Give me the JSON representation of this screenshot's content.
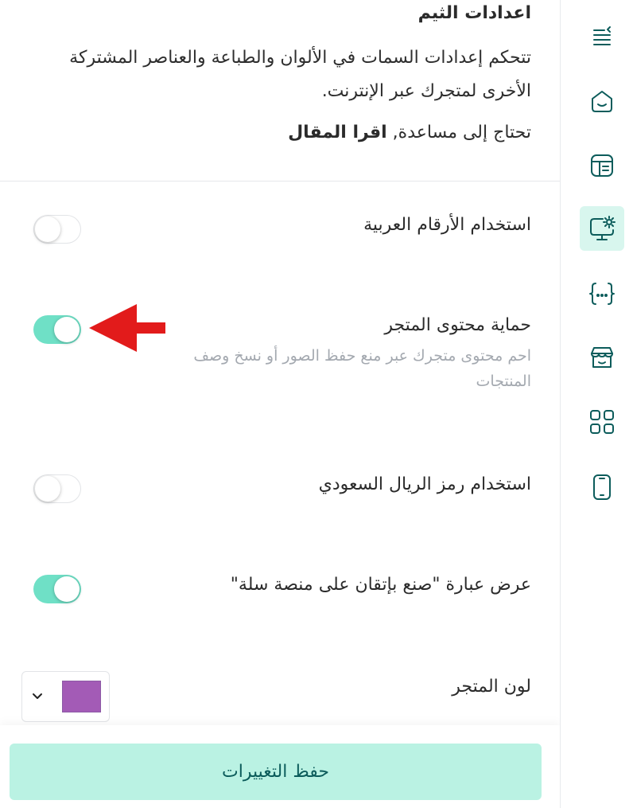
{
  "header": {
    "title": "اعدادات الثيم",
    "description": "تتحكم إعدادات السمات في الألوان والطباعة والعناصر المشتركة الأخرى لمتجرك عبر الإنترنت.",
    "help_prefix": "تحتاج إلى مساعدة,",
    "help_link": "اقرا المقال"
  },
  "settings": [
    {
      "label": "استخدام الأرقام العربية",
      "enabled": false
    },
    {
      "label": "حماية محتوى المتجر",
      "description": "احم محتوى متجرك عبر منع حفظ الصور أو نسخ وصف المنتجات",
      "enabled": true
    },
    {
      "label": "استخدام رمز الريال السعودي",
      "enabled": false
    },
    {
      "label": "عرض عبارة \"صنع بإتقان على منصة سلة\"",
      "enabled": true
    }
  ],
  "store_color": {
    "label": "لون المتجر",
    "value": "#a35bb6",
    "icon": "chevron-down-icon"
  },
  "footer": {
    "save_label": "حفظ التغييرات"
  },
  "annotation": {
    "icon": "red-arrow-icon",
    "color": "#e21b1b"
  },
  "sidebar": {
    "icons": [
      "menu-collapse-icon",
      "home-icon",
      "layout-icon",
      "theme-settings-icon",
      "code-braces-icon",
      "store-icon",
      "apps-grid-icon",
      "mobile-icon"
    ],
    "active": "theme-settings-icon",
    "accent": "#0c5c5b"
  }
}
